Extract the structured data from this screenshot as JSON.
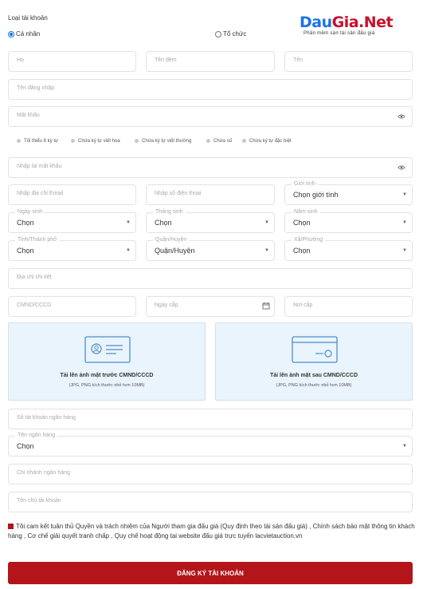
{
  "account_type": {
    "label": "Loại tài khoản",
    "options": [
      {
        "label": "Cá nhân",
        "selected": true
      },
      {
        "label": "Tổ chức",
        "selected": false
      }
    ]
  },
  "brand": {
    "logo_text": "DauGia.Net",
    "logo_part1": "Dau",
    "logo_part2": "Gia.Net",
    "tagline": "Phần mềm sàn tài sản đấu giá",
    "color_blue": "#1a73e8",
    "color_red": "#c8102e"
  },
  "form": {
    "last_name_placeholder": "Họ",
    "middle_name_placeholder": "Tên đệm",
    "first_name_placeholder": "Tên",
    "username_placeholder": "Tên đăng nhập",
    "password_placeholder": "Mật khẩu",
    "password_rules": [
      "Tối thiểu 8 ký tự",
      "Chứa ký tự viết hoa",
      "Chứa ký tự viết thường",
      "Chứa số",
      "Chứa ký tự đặc biệt"
    ],
    "confirm_password_placeholder": "Nhập lại mật khẩu",
    "email_placeholder": "Nhập địa chỉ Email",
    "phone_placeholder": "Nhập số điện thoại",
    "gender_label": "Giới tính",
    "gender_value": "Chọn giới tính",
    "birth_day_label": "Ngày sinh",
    "birth_day_value": "Chọn",
    "birth_month_label": "Tháng sinh",
    "birth_month_value": "Chọn",
    "birth_year_label": "Năm sinh",
    "birth_year_value": "Chọn",
    "province_label": "Tỉnh/Thành phố",
    "province_value": "Chọn",
    "district_label": "Quận/Huyện",
    "district_value": "Quận/Huyện",
    "ward_label": "Xã/Phường",
    "ward_value": "Chọn",
    "address_placeholder": "Địa chỉ chi tiết",
    "id_number_placeholder": "CMND/CCCD",
    "issue_date_placeholder": "Ngày cấp",
    "issue_place_placeholder": "Nơi cấp",
    "upload_front_title": "Tải lên ảnh mặt trước CMND/CCCD",
    "upload_back_title": "Tải lên ảnh mặt sau CMND/CCCD",
    "upload_hint": "(JPG, PNG kích thước nhỏ hơn 10MB)",
    "bank_account_placeholder": "Số tài khoản ngân hàng",
    "bank_name_label": "Tên ngân hàng",
    "bank_name_value": "Chọn",
    "bank_branch_placeholder": "Chi nhánh ngân hàng",
    "account_holder_placeholder": "Tên chủ tài khoản"
  },
  "agreement": {
    "text": "Tôi cam kết tuân thủ Quyền và trách nhiệm của Người tham gia đấu giá (Quy định theo tài sản đấu giá) , Chính sách bảo mật thông tin khách hàng , Cơ chế giải quyết tranh chấp , Quy chế hoạt động tại website đấu giá trực tuyến lacvietauction.vn"
  },
  "submit_label": "ĐĂNG KÝ TÀI KHOẢN",
  "colors": {
    "accent": "#b3151a",
    "upload_bg": "#eaf4fc",
    "border": "#e2e2e2"
  }
}
